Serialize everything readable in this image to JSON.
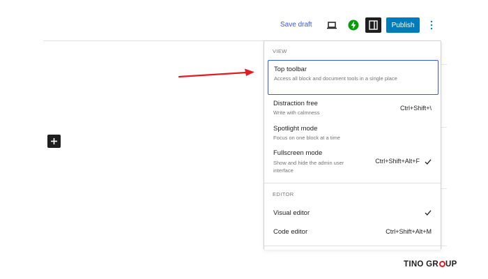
{
  "header": {
    "save_draft_label": "Save draft",
    "preview_icon": "laptop-icon",
    "jetpack_icon": "jetpack-icon",
    "settings_icon": "sidebar-panel-icon",
    "publish_label": "Publish",
    "options_icon": "more-vertical-icon"
  },
  "menu": {
    "view_group_label": "VIEW",
    "view_items": [
      {
        "title": "Top toolbar",
        "description": "Access all block and document tools in a single place",
        "shortcut": "",
        "checked": false
      },
      {
        "title": "Distraction free",
        "description": "Write with calmness",
        "shortcut": "Ctrl+Shift+\\",
        "checked": false
      },
      {
        "title": "Spotlight mode",
        "description": "Focus on one block at a time",
        "shortcut": "",
        "checked": false
      },
      {
        "title": "Fullscreen mode",
        "description": "Show and hide the admin user interface",
        "shortcut": "Ctrl+Shift+Alt+F",
        "checked": true
      }
    ],
    "editor_group_label": "EDITOR",
    "editor_items": [
      {
        "title": "Visual editor",
        "shortcut": "",
        "checked": true
      },
      {
        "title": "Code editor",
        "shortcut": "Ctrl+Shift+Alt+M",
        "checked": false
      }
    ]
  },
  "canvas": {
    "inserter_icon": "plus-icon"
  },
  "annotation": {
    "arrow_color": "#e31b23"
  },
  "colors": {
    "accent": "#3858e9",
    "publish": "#007cba",
    "dark": "#1e1e1e",
    "jetpack_green": "#069e08"
  },
  "branding": {
    "logo_text": "TINOGROUP"
  }
}
